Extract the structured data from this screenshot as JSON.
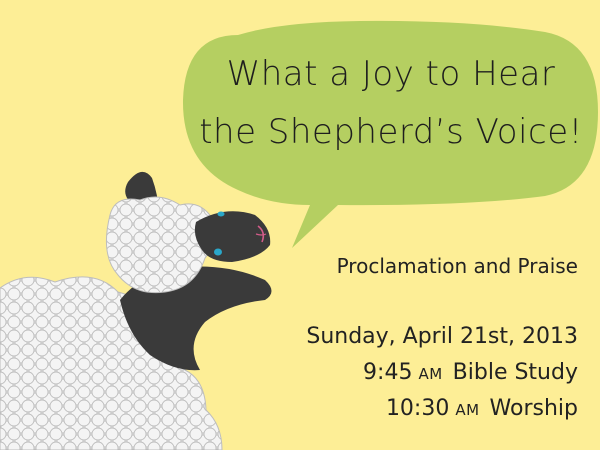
{
  "headline": {
    "line1": "What a Joy to Hear",
    "line2": "the Shepherd’s Voice!"
  },
  "subtitle": "Proclamation and Praise",
  "date": "Sunday, April 21st, 2013",
  "schedule": [
    {
      "time": "9:45",
      "period": "AM",
      "event": "Bible Study"
    },
    {
      "time": "10:30",
      "period": "AM",
      "event": "Worship"
    }
  ],
  "colors": {
    "background": "#fdee96",
    "bubble": "#b5cf61",
    "wool": "#e6e6e6",
    "sheep_face": "#3a3a3a",
    "eye": "#2aa7c9",
    "text": "#222222"
  },
  "icons": [
    "sheep-illustration",
    "speech-bubble"
  ]
}
